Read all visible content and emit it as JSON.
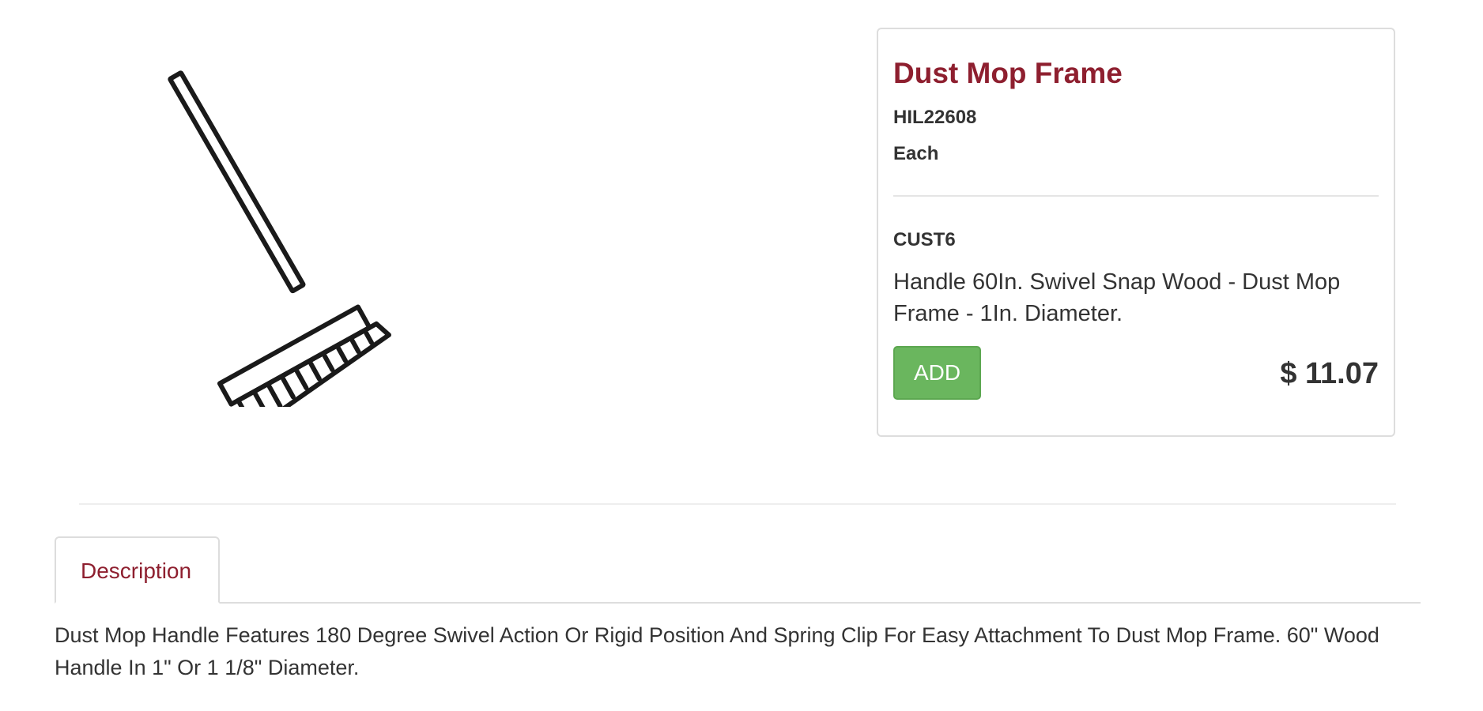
{
  "product": {
    "title": "Dust Mop Frame",
    "sku": "HIL22608",
    "unit": "Each",
    "customer_code": "CUST6",
    "short_description": "Handle 60In. Swivel Snap Wood - Dust Mop Frame - 1In. Diameter.",
    "add_label": "ADD",
    "price": "$ 11.07",
    "image_icon": "dust-mop-icon"
  },
  "tabs": {
    "description_label": "Description"
  },
  "description": {
    "text": "Dust Mop Handle Features 180 Degree Swivel Action Or Rigid Position And Spring Clip For Easy Attachment To Dust Mop Frame. 60\" Wood Handle In 1\" Or 1 1/8\" Diameter."
  },
  "colors": {
    "title_accent": "#8e1f2f",
    "add_button": "#6ab65e",
    "text": "#333333",
    "border": "#dddddd"
  }
}
